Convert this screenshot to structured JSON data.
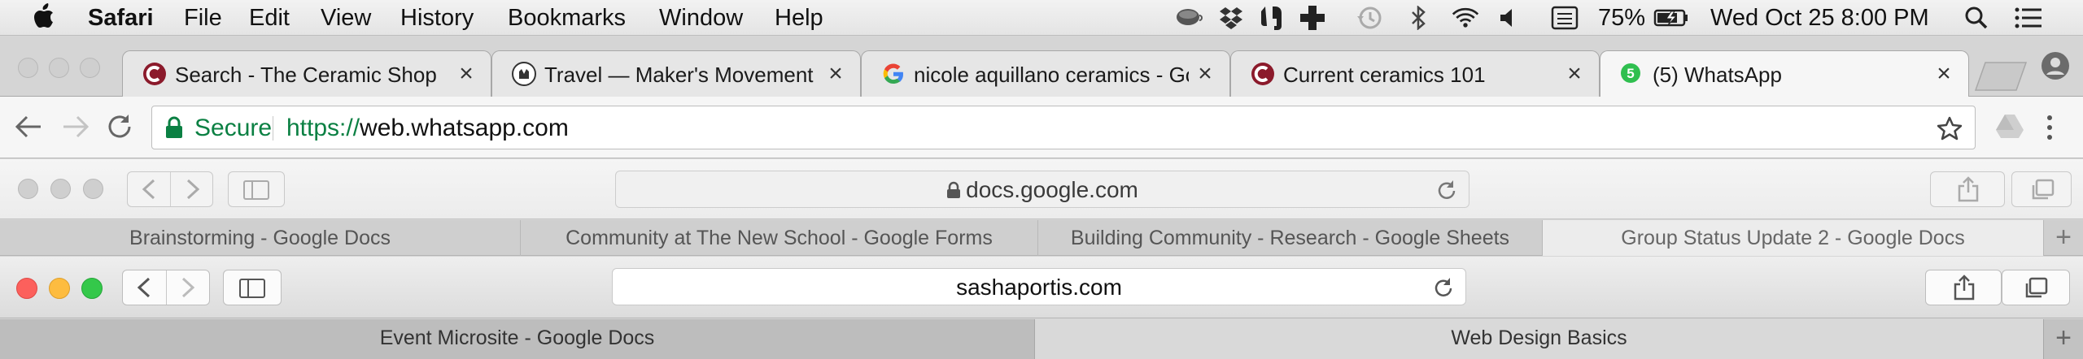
{
  "menubar": {
    "app_name": "Safari",
    "menus": [
      "File",
      "Edit",
      "View",
      "History",
      "Bookmarks",
      "Window",
      "Help"
    ],
    "status_icons": [
      "cup-icon",
      "dropbox-icon",
      "evernote-icon",
      "plus-icon",
      "time-machine-icon",
      "bluetooth-icon",
      "wifi-icon",
      "volume-icon",
      "keyboard-icon"
    ],
    "battery_percent": "75%",
    "datetime": "Wed Oct 25  8:00 PM"
  },
  "chrome": {
    "tabs": [
      {
        "title": "Search - The Ceramic Shop",
        "favicon": "ceramic-shop-icon"
      },
      {
        "title": "Travel — Maker's Movement",
        "favicon": "makers-movement-icon"
      },
      {
        "title": "nicole aquillano ceramics - Go",
        "favicon": "google-icon"
      },
      {
        "title": "Current ceramics 101",
        "favicon": "ceramic-shop-icon"
      },
      {
        "title": "(5) WhatsApp",
        "favicon": "whatsapp-badge-icon",
        "badge": "5"
      }
    ],
    "active_tab": 4,
    "omnibox": {
      "security_label": "Secure",
      "url_scheme": "https://",
      "url_host": "web.whatsapp.com"
    },
    "accent_color": "#0b8043"
  },
  "safari_back": {
    "address": "docs.google.com",
    "tabs": [
      "Brainstorming - Google Docs",
      "Community at The New School - Google Forms",
      "Building Community - Research - Google Sheets",
      "Group Status Update 2 - Google Docs"
    ],
    "active_tab": 3
  },
  "safari_front": {
    "address": "sashaportis.com",
    "tabs": [
      "Event Microsite - Google Docs",
      "Web Design Basics"
    ],
    "active_tab": 1,
    "traffic_colors": [
      "#fc605c",
      "#fdbc40",
      "#34c84a"
    ]
  }
}
